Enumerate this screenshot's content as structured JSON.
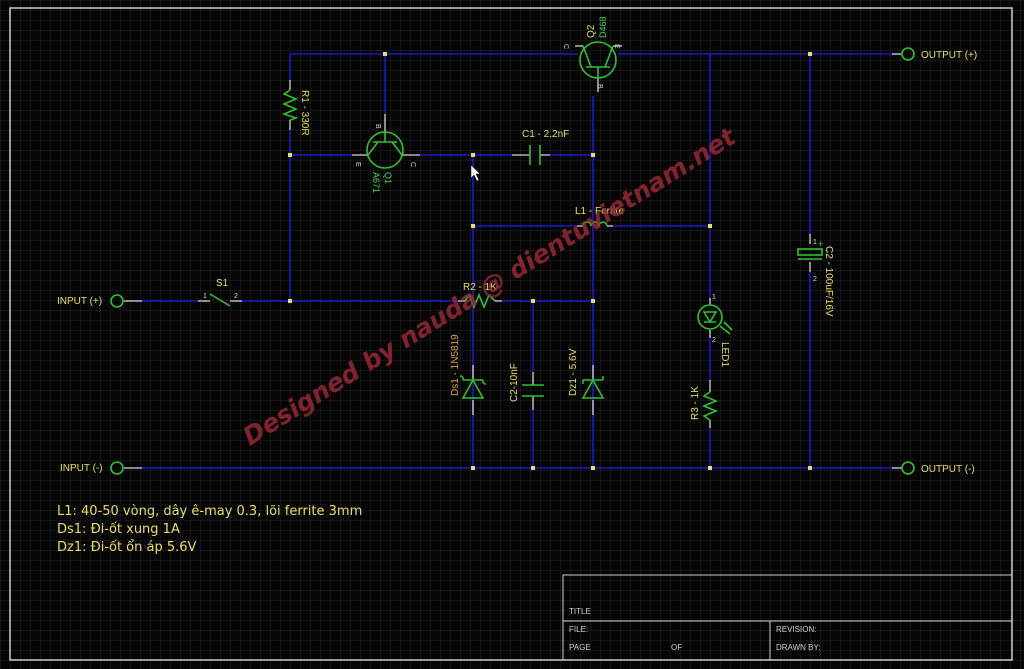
{
  "colors": {
    "wire": "#1a1ac8",
    "component": "#2fc22f",
    "label": "#e6e05a",
    "pin": "#d8d8d8",
    "junction": "#e6e05a",
    "watermark": "#a02a38",
    "grid": "#242424"
  },
  "terminals": {
    "input_pos": "INPUT (+)",
    "input_neg": "INPUT (-)",
    "output_pos": "OUTPUT (+)",
    "output_neg": "OUTPUT (-)"
  },
  "components": {
    "q1": {
      "ref": "Q1",
      "value": "A671",
      "pins": [
        "B",
        "E",
        "C"
      ]
    },
    "q2": {
      "ref": "Q2",
      "value": "D468",
      "pins": [
        "C",
        "E",
        "B"
      ]
    },
    "r1": "R1 - 330R",
    "r2": "R2 - 1K",
    "r3": "R3 - 1K",
    "c1": "C1 - 2.2nF",
    "c2_small": "C2-10nF",
    "c2_big": "C2 - 100uF/16V",
    "l1": "L1 - Ferrite",
    "s1": {
      "ref": "S1",
      "pins": [
        "1",
        "2"
      ]
    },
    "ds1": "Ds1 - 1N5819",
    "dz1": "Dz1 - 5.6V",
    "led1": {
      "ref": "LED1",
      "pins": [
        "1",
        "2"
      ]
    },
    "c2_pins": [
      "1",
      "2",
      "+"
    ]
  },
  "notes": [
    "L1: 40-50 vòng, dây ê-may 0.3, lõi ferrite 3mm",
    "Ds1: Đi-ốt xung 1A",
    "Dz1: Đi-ốt ổn áp 5.6V"
  ],
  "watermark": "Designed by nauda @ dientuvietnam.net",
  "title_block": {
    "title": "TITLE",
    "file": "FILE:",
    "page": "PAGE",
    "of": "OF",
    "revision": "REVISION:",
    "drawn_by": "DRAWN BY:"
  }
}
